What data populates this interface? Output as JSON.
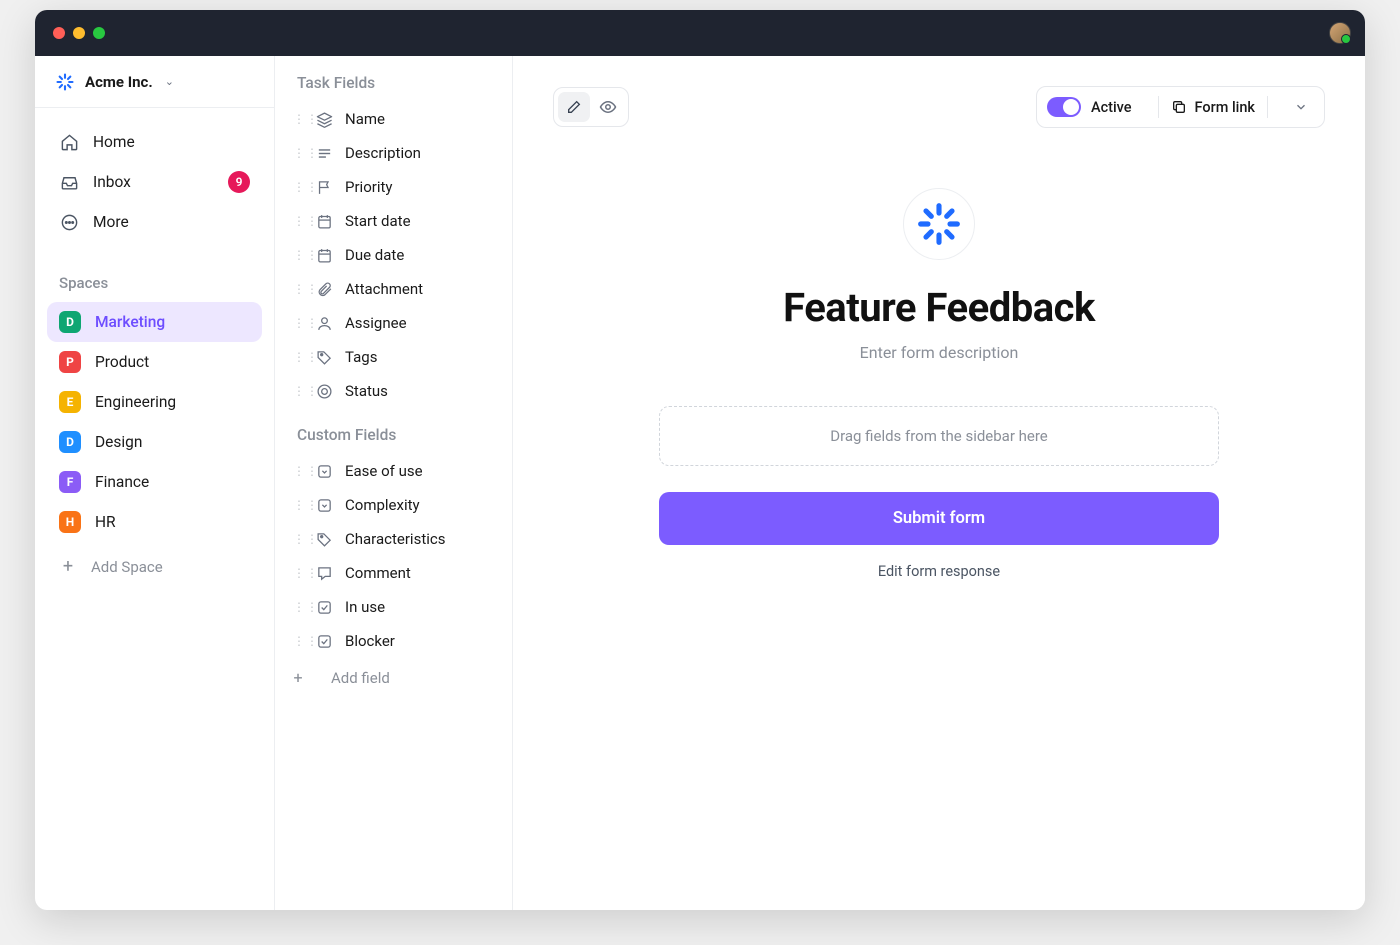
{
  "org_name": "Acme Inc.",
  "nav": {
    "home": "Home",
    "inbox": "Inbox",
    "inbox_badge": "9",
    "more": "More"
  },
  "spaces_label": "Spaces",
  "spaces": [
    {
      "letter": "D",
      "label": "Marketing",
      "color": "#0ea672",
      "active": true
    },
    {
      "letter": "P",
      "label": "Product",
      "color": "#ef4444"
    },
    {
      "letter": "E",
      "label": "Engineering",
      "color": "#f5b301"
    },
    {
      "letter": "D",
      "label": "Design",
      "color": "#1f8fff"
    },
    {
      "letter": "F",
      "label": "Finance",
      "color": "#8b5cf6"
    },
    {
      "letter": "H",
      "label": "HR",
      "color": "#f97316"
    }
  ],
  "add_space": "Add Space",
  "task_fields_header": "Task Fields",
  "task_fields": [
    {
      "icon": "layers",
      "label": "Name"
    },
    {
      "icon": "lines",
      "label": "Description"
    },
    {
      "icon": "flag",
      "label": "Priority"
    },
    {
      "icon": "calendar",
      "label": "Start date"
    },
    {
      "icon": "calendar",
      "label": "Due date"
    },
    {
      "icon": "attachment",
      "label": "Attachment"
    },
    {
      "icon": "person",
      "label": "Assignee"
    },
    {
      "icon": "tag",
      "label": "Tags"
    },
    {
      "icon": "status",
      "label": "Status"
    }
  ],
  "custom_fields_header": "Custom Fields",
  "custom_fields": [
    {
      "icon": "dropdown",
      "label": "Ease of use"
    },
    {
      "icon": "dropdown",
      "label": "Complexity"
    },
    {
      "icon": "tag",
      "label": "Characteristics"
    },
    {
      "icon": "comment",
      "label": "Comment"
    },
    {
      "icon": "checkbox",
      "label": "In use"
    },
    {
      "icon": "checkbox",
      "label": "Blocker"
    }
  ],
  "add_field": "Add field",
  "toolbar": {
    "active_label": "Active",
    "form_link_label": "Form link"
  },
  "form": {
    "title": "Feature Feedback",
    "description_placeholder": "Enter form description",
    "dropzone": "Drag fields from the sidebar here",
    "submit": "Submit form",
    "edit_response": "Edit form response"
  }
}
